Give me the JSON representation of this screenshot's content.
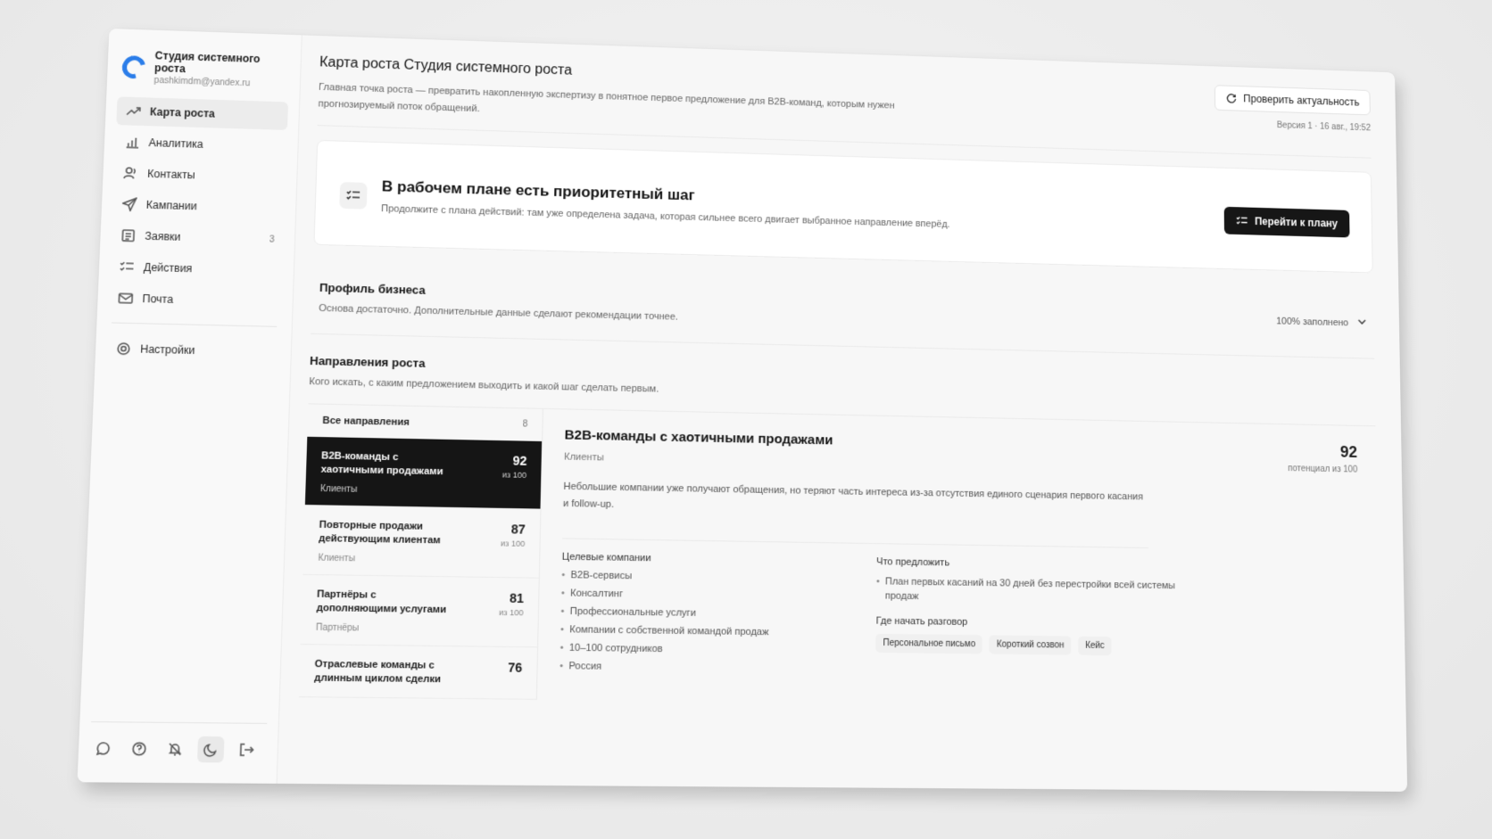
{
  "app": {
    "name": "Студия системного роста",
    "email": "pashkimdm@yandex.ru"
  },
  "sidebar": {
    "items": [
      {
        "label": "Карта роста",
        "icon": "trend-up-icon"
      },
      {
        "label": "Аналитика",
        "icon": "analytics-icon"
      },
      {
        "label": "Контакты",
        "icon": "contacts-icon"
      },
      {
        "label": "Кампании",
        "icon": "send-icon"
      },
      {
        "label": "Заявки",
        "icon": "requests-icon",
        "badge": "3"
      },
      {
        "label": "Действия",
        "icon": "checklist-icon"
      },
      {
        "label": "Почта",
        "icon": "mail-icon"
      }
    ],
    "settings_label": "Настройки"
  },
  "header": {
    "title": "Карта роста Студия системного роста",
    "description": "Главная точка роста — превратить накопленную экспертизу в понятное первое предложение для B2B-команд, которым нужен прогнозируемый поток обращений.",
    "check_button": "Проверить актуальность",
    "version": "Версия 1 · 16 авг., 19:52"
  },
  "priority": {
    "title": "В рабочем плане есть приоритетный шаг",
    "subtitle": "Продолжите с плана действий: там уже определена задача, которая сильнее всего двигает выбранное направление вперёд.",
    "button": "Перейти к плану"
  },
  "profile": {
    "title": "Профиль бизнеса",
    "subtitle": "Основа достаточно. Дополнительные данные сделают рекомендации точнее.",
    "fill": "100% заполнено"
  },
  "directions": {
    "title": "Направления роста",
    "subtitle": "Кого искать, с каким предложением выходить и какой шаг сделать первым.",
    "all_label": "Все направления",
    "all_count": "8",
    "list": [
      {
        "name": "B2B-команды с хаотичными продажами",
        "category": "Клиенты",
        "score": "92",
        "of": "из 100"
      },
      {
        "name": "Повторные продажи действующим клиентам",
        "category": "Клиенты",
        "score": "87",
        "of": "из 100"
      },
      {
        "name": "Партнёры с дополняющими услугами",
        "category": "Партнёры",
        "score": "81",
        "of": "из 100"
      },
      {
        "name": "Отраслевые команды с длинным циклом сделки",
        "category": "",
        "score": "76",
        "of": ""
      }
    ]
  },
  "detail": {
    "title": "B2B-команды с хаотичными продажами",
    "category": "Клиенты",
    "score": "92",
    "score_of": "потенциал из 100",
    "description": "Небольшие компании уже получают обращения, но теряют часть интереса из-за отсутствия единого сценария первого касания и follow-up.",
    "targets_title": "Целевые компании",
    "targets": [
      "B2B-сервисы",
      "Консалтинг",
      "Профессиональные услуги",
      "Компании с собственной командой продаж",
      "10–100 сотрудников",
      "Россия"
    ],
    "offer_title": "Что предложить",
    "offer": "План первых касаний на 30 дней без перестройки всей системы продаж",
    "start_title": "Где начать разговор",
    "tags": [
      "Персональное письмо",
      "Короткий созвон",
      "Кейс"
    ]
  }
}
